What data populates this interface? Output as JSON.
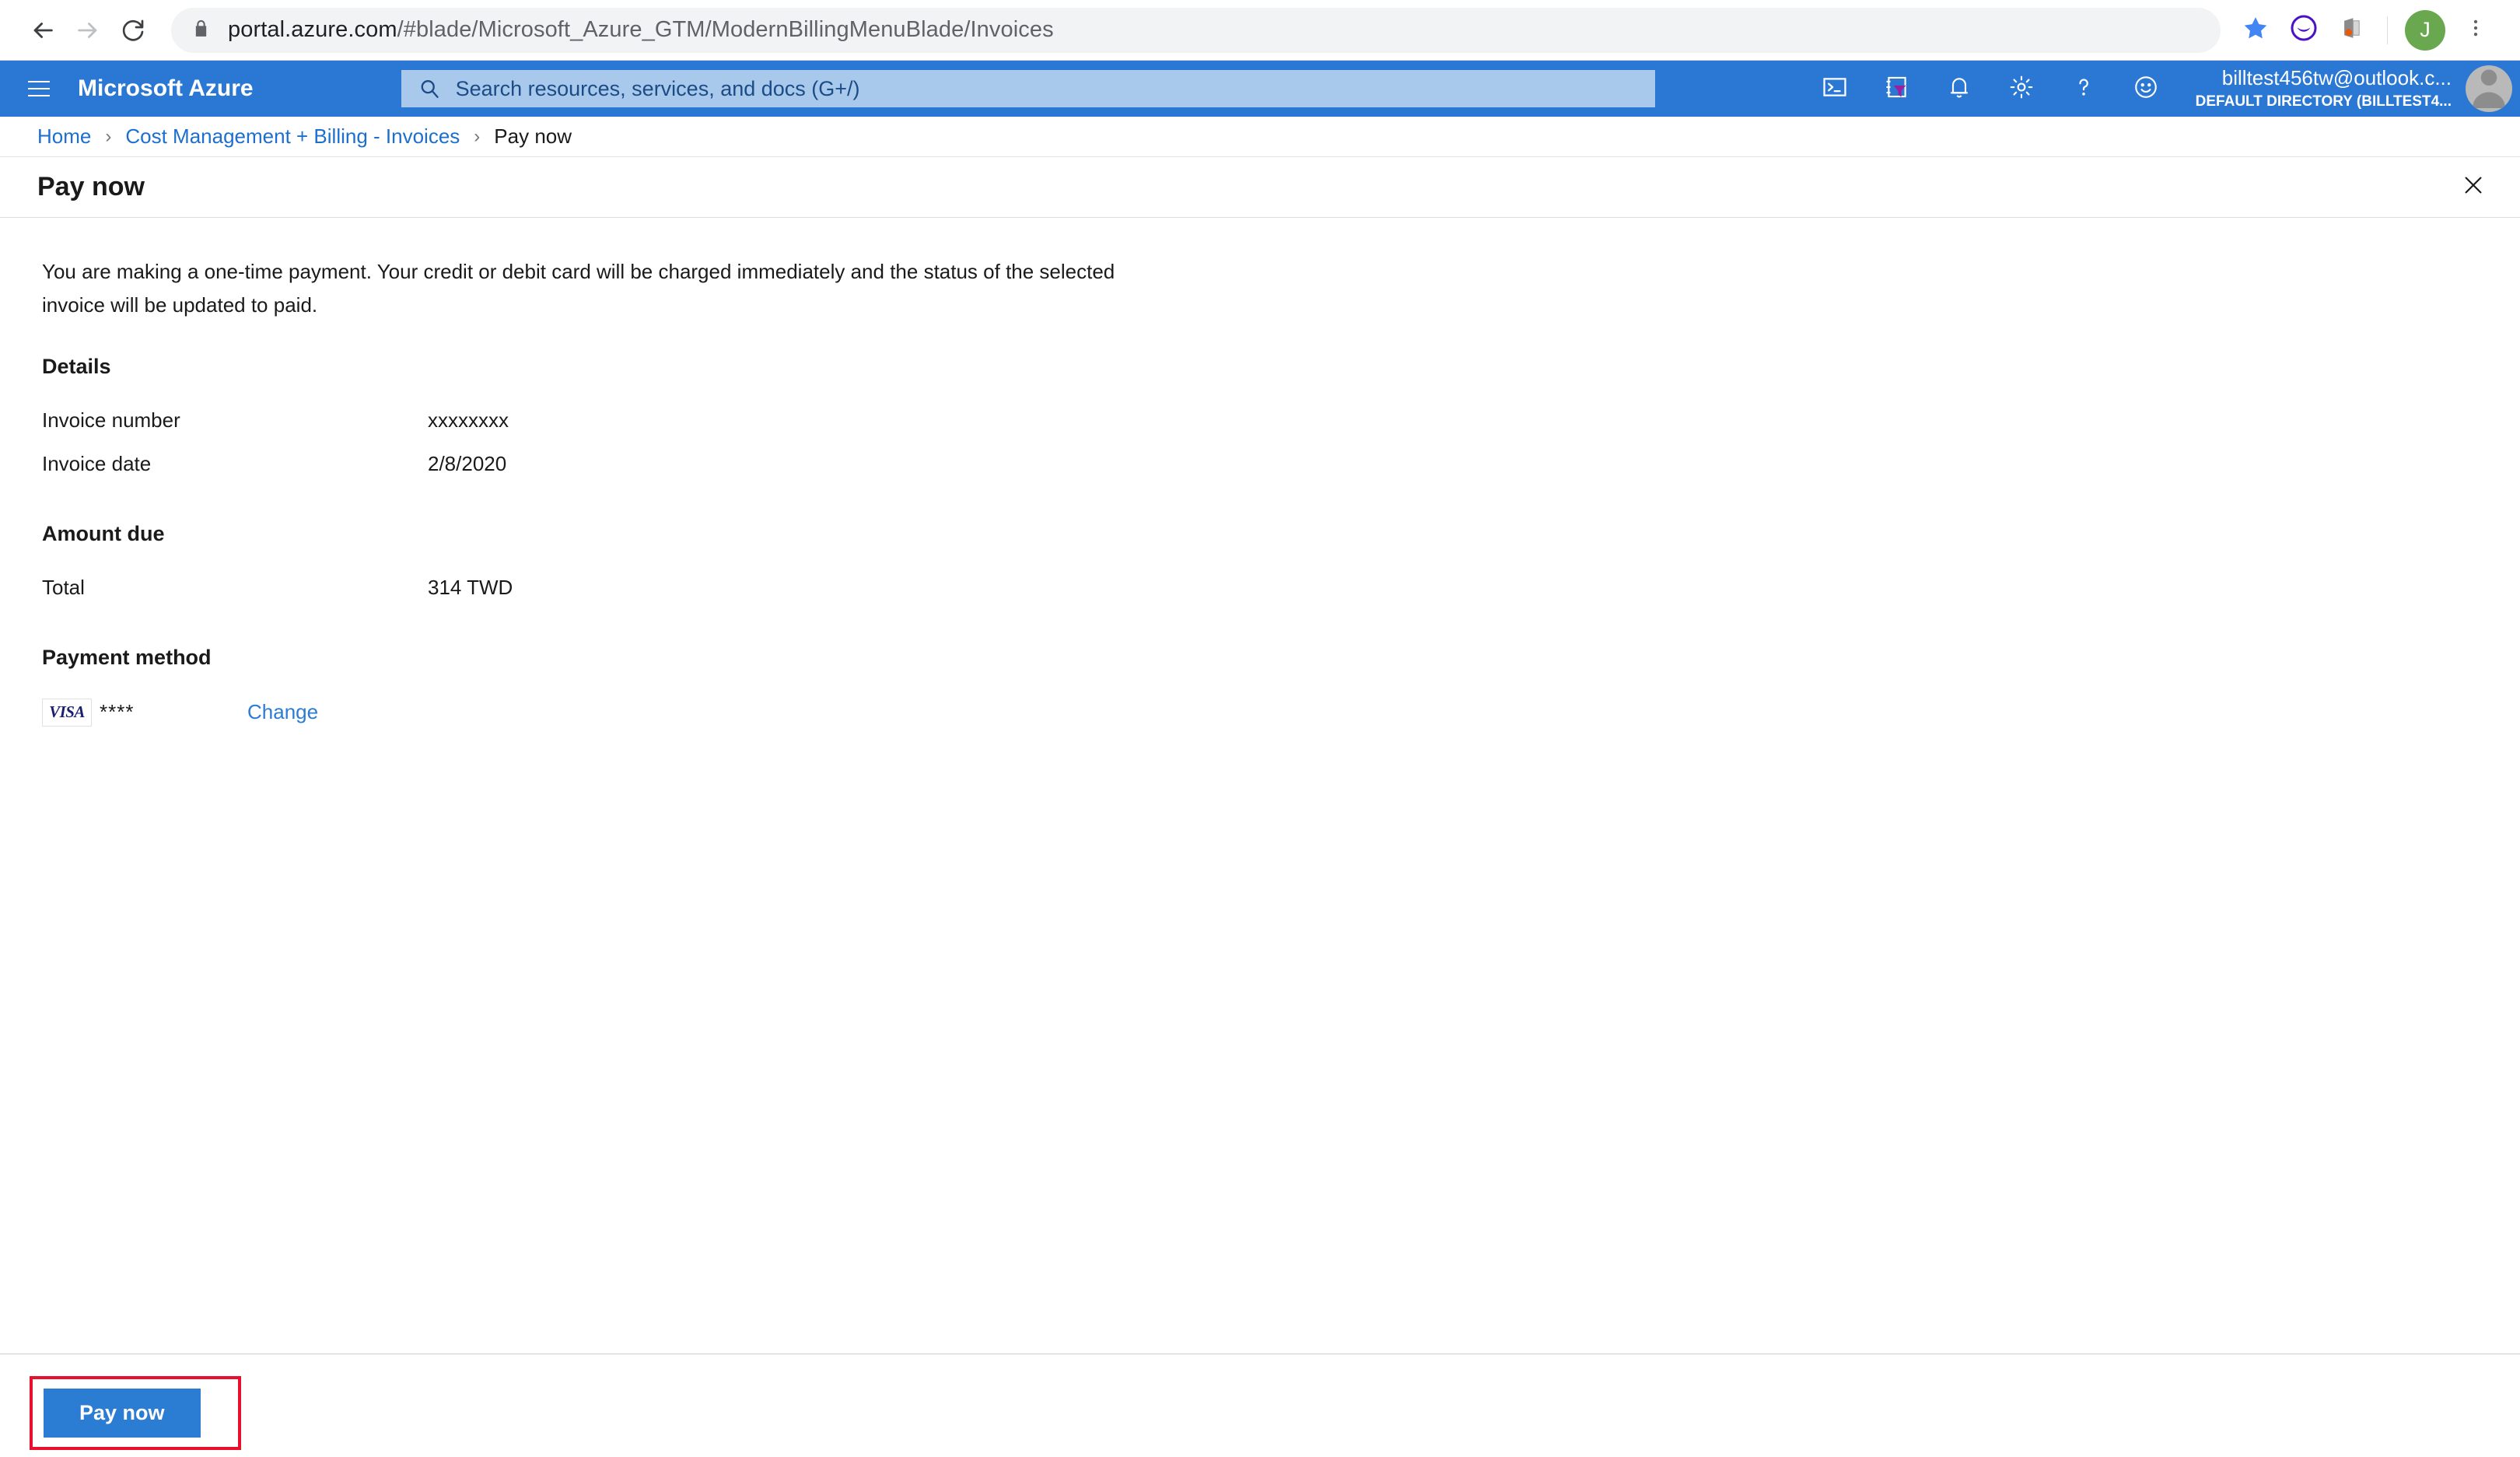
{
  "browser": {
    "back_icon": "back-arrow-icon",
    "forward_icon": "forward-arrow-icon",
    "reload_icon": "reload-icon",
    "lock_icon": "lock-icon",
    "url_domain": "portal.azure.com",
    "url_path": "/#blade/Microsoft_Azure_GTM/ModernBillingMenuBlade/Invoices",
    "url_full": "portal.azure.com/#blade/Microsoft_Azure_GTM/ModernBillingMenuBlade/Invoices",
    "bookmark_icon": "star-icon",
    "extension_icon_1": "purple-moon-circle-icon",
    "extension_icon_2": "office-extension-icon",
    "profile_initial": "J",
    "menu_icon": "three-dot-menu-icon"
  },
  "azure_header": {
    "menu_icon": "hamburger-menu-icon",
    "brand": "Microsoft Azure",
    "search": {
      "icon": "search-icon",
      "placeholder": "Search resources, services, and docs (G+/)",
      "value": ""
    },
    "icons": [
      {
        "name": "cloud-shell-icon"
      },
      {
        "name": "directory-filter-icon"
      },
      {
        "name": "notifications-bell-icon"
      },
      {
        "name": "settings-gear-icon"
      },
      {
        "name": "help-question-icon"
      },
      {
        "name": "feedback-smiley-icon"
      }
    ],
    "account": {
      "email": "billtest456tw@outlook.c...",
      "directory": "DEFAULT DIRECTORY (BILLTEST4...",
      "avatar_icon": "user-avatar-icon"
    },
    "accent_color": "#2b78d4"
  },
  "breadcrumb": {
    "items": [
      {
        "label": "Home",
        "current": false
      },
      {
        "label": "Cost Management + Billing - Invoices",
        "current": false
      },
      {
        "label": "Pay now",
        "current": true
      }
    ],
    "separator": "›"
  },
  "blade": {
    "title": "Pay now",
    "close_icon": "close-icon",
    "intro": "You are making a one-time payment. Your credit or debit card will be charged immediately and the status of the selected invoice will be updated to paid.",
    "details": {
      "heading": "Details",
      "rows": [
        {
          "label": "Invoice number",
          "value": "xxxxxxxx"
        },
        {
          "label": "Invoice date",
          "value": "2/8/2020"
        }
      ]
    },
    "amount_due": {
      "heading": "Amount due",
      "rows": [
        {
          "label": "Total",
          "value": "314 TWD"
        }
      ]
    },
    "payment_method": {
      "heading": "Payment method",
      "card_brand": "VISA",
      "card_mask": "****",
      "change_label": "Change",
      "change_link_color": "#2b7cd3"
    }
  },
  "footer": {
    "pay_button_label": "Pay now",
    "pay_button_color": "#2b7cd3",
    "highlight_color": "#e8112d"
  }
}
